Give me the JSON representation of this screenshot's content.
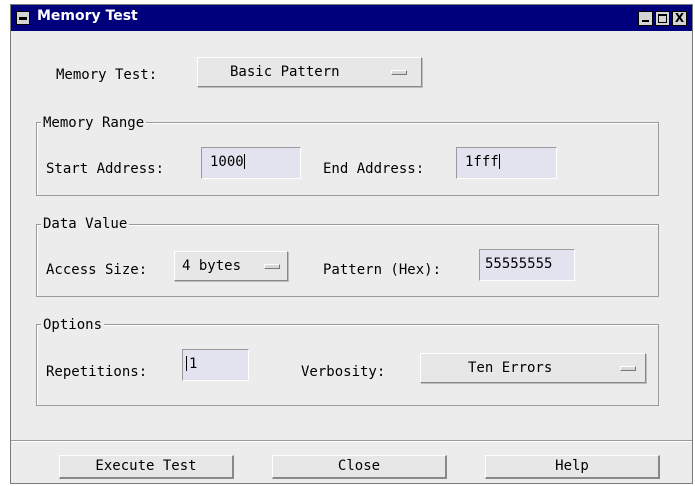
{
  "window": {
    "title": "Memory Test",
    "title_bar_color": "#00007c",
    "close_glyph": "X"
  },
  "memory_test": {
    "label": "Memory Test:",
    "selected": "Basic Pattern"
  },
  "memory_range": {
    "group_label": "Memory Range",
    "start_label": "Start Address:",
    "start_value": "1000",
    "end_label": "End Address:",
    "end_value": "1fff"
  },
  "data_value": {
    "group_label": "Data Value",
    "access_label": "Access Size:",
    "access_selected": "4 bytes",
    "pattern_label": "Pattern (Hex):",
    "pattern_value": "55555555"
  },
  "options": {
    "group_label": "Options",
    "repetitions_label": "Repetitions:",
    "repetitions_value": "1",
    "verbosity_label": "Verbosity:",
    "verbosity_selected": "Ten Errors"
  },
  "buttons": {
    "execute": "Execute Test",
    "close": "Close",
    "help": "Help"
  }
}
